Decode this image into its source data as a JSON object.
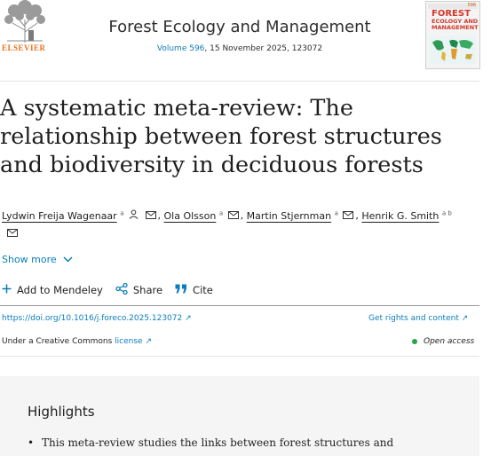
{
  "header": {
    "publisher": "ELSEVIER",
    "journal_title": "Forest Ecology and Management",
    "volume_link": "Volume 596",
    "issue_info": ", 15 November 2025, 123072",
    "cover": {
      "number": "596",
      "title_line1": "FOREST",
      "title_line2": "ECOLOGY AND\nMANAGEMENT"
    }
  },
  "article": {
    "title": "A systematic meta-review: The relationship between forest structures and biodiversity in deciduous forests",
    "authors": [
      {
        "name": "Lydwin Freija Wagenaar",
        "sup": "a"
      },
      {
        "name": "Ola Olsson",
        "sup": "a"
      },
      {
        "name": "Martin Stjernman",
        "sup": "a"
      },
      {
        "name": "Henrik G. Smith",
        "sup": "a b"
      }
    ],
    "show_more": "Show more"
  },
  "toolbar": {
    "mendeley": "Add to Mendeley",
    "share": "Share",
    "cite": "Cite"
  },
  "links": {
    "doi": "https://doi.org/10.1016/j.foreco.2025.123072",
    "rights": "Get rights and content",
    "license_prefix": "Under a Creative Commons ",
    "license_link": "license",
    "open_access": "Open access"
  },
  "highlights": {
    "title": "Highlights",
    "items": [
      "This meta-review studies the links between forest structures and"
    ]
  },
  "colors": {
    "link": "#0c7dbb",
    "publisher": "#e9711c",
    "open_access_dot": "#29a249"
  }
}
